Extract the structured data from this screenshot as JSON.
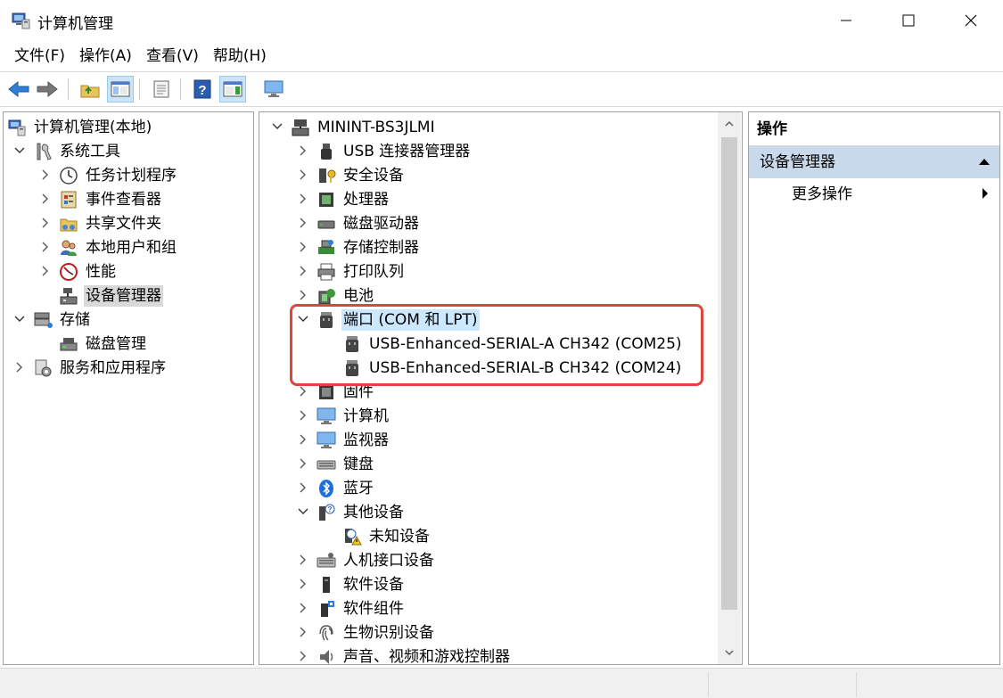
{
  "window": {
    "title": "计算机管理",
    "icon": "computer-management-icon",
    "controls": [
      "minimize",
      "maximize",
      "close"
    ]
  },
  "menu": [
    "文件(F)",
    "操作(A)",
    "查看(V)",
    "帮助(H)"
  ],
  "toolbar": [
    {
      "name": "back-button",
      "icon": "back-arrow-icon"
    },
    {
      "name": "forward-button",
      "icon": "forward-arrow-icon"
    },
    {
      "name": "up-folder-button",
      "icon": "up-folder-icon"
    },
    {
      "name": "show-hide-tree-button",
      "icon": "console-tree-icon",
      "pressed": true
    },
    {
      "name": "properties-button",
      "icon": "properties-icon"
    },
    {
      "name": "help-button",
      "icon": "help-icon"
    },
    {
      "name": "show-hide-action-pane-button",
      "icon": "action-pane-icon",
      "pressed": true
    },
    {
      "name": "monitor-button",
      "icon": "monitor-icon"
    }
  ],
  "left_tree": [
    {
      "label": "计算机管理(本地)",
      "icon": "computer-management-icon",
      "level": 0,
      "chevron": "none"
    },
    {
      "label": "系统工具",
      "icon": "tools-icon",
      "level": 1,
      "chevron": "down"
    },
    {
      "label": "任务计划程序",
      "icon": "clock-icon",
      "level": 2,
      "chevron": "right"
    },
    {
      "label": "事件查看器",
      "icon": "event-viewer-icon",
      "level": 2,
      "chevron": "right"
    },
    {
      "label": "共享文件夹",
      "icon": "shared-folder-icon",
      "level": 2,
      "chevron": "right"
    },
    {
      "label": "本地用户和组",
      "icon": "users-icon",
      "level": 2,
      "chevron": "right"
    },
    {
      "label": "性能",
      "icon": "performance-icon",
      "level": 2,
      "chevron": "right"
    },
    {
      "label": "设备管理器",
      "icon": "device-manager-icon",
      "level": 2,
      "chevron": "none",
      "selected": true
    },
    {
      "label": "存储",
      "icon": "storage-icon",
      "level": 1,
      "chevron": "down"
    },
    {
      "label": "磁盘管理",
      "icon": "disk-management-icon",
      "level": 2,
      "chevron": "none"
    },
    {
      "label": "服务和应用程序",
      "icon": "services-icon",
      "level": 1,
      "chevron": "right"
    }
  ],
  "device_tree": [
    {
      "label": "MININT-BS3JLMI",
      "icon": "computer-root-icon",
      "level": 0,
      "chevron": "down"
    },
    {
      "label": "USB 连接器管理器",
      "icon": "usb-connector-icon",
      "level": 1,
      "chevron": "right"
    },
    {
      "label": "安全设备",
      "icon": "security-device-icon",
      "level": 1,
      "chevron": "right"
    },
    {
      "label": "处理器",
      "icon": "processor-icon",
      "level": 1,
      "chevron": "right"
    },
    {
      "label": "磁盘驱动器",
      "icon": "disk-drive-icon",
      "level": 1,
      "chevron": "right"
    },
    {
      "label": "存储控制器",
      "icon": "storage-controller-icon",
      "level": 1,
      "chevron": "right"
    },
    {
      "label": "打印队列",
      "icon": "printer-icon",
      "level": 1,
      "chevron": "right"
    },
    {
      "label": "电池",
      "icon": "battery-icon",
      "level": 1,
      "chevron": "right"
    },
    {
      "label": "端口 (COM 和 LPT)",
      "icon": "port-icon",
      "level": 1,
      "chevron": "down",
      "focused": true
    },
    {
      "label": "USB-Enhanced-SERIAL-A CH342 (COM25)",
      "icon": "port-icon",
      "level": 2,
      "chevron": "none"
    },
    {
      "label": "USB-Enhanced-SERIAL-B CH342 (COM24)",
      "icon": "port-icon",
      "level": 2,
      "chevron": "none"
    },
    {
      "label": "固件",
      "icon": "firmware-icon",
      "level": 1,
      "chevron": "right"
    },
    {
      "label": "计算机",
      "icon": "computer-icon",
      "level": 1,
      "chevron": "right"
    },
    {
      "label": "监视器",
      "icon": "monitor-icon",
      "level": 1,
      "chevron": "right"
    },
    {
      "label": "键盘",
      "icon": "keyboard-icon",
      "level": 1,
      "chevron": "right"
    },
    {
      "label": "蓝牙",
      "icon": "bluetooth-icon",
      "level": 1,
      "chevron": "right"
    },
    {
      "label": "其他设备",
      "icon": "other-devices-icon",
      "level": 1,
      "chevron": "down"
    },
    {
      "label": "未知设备",
      "icon": "unknown-device-warning-icon",
      "level": 2,
      "chevron": "none"
    },
    {
      "label": "人机接口设备",
      "icon": "hid-icon",
      "level": 1,
      "chevron": "right"
    },
    {
      "label": "软件设备",
      "icon": "software-device-icon",
      "level": 1,
      "chevron": "right"
    },
    {
      "label": "软件组件",
      "icon": "software-component-icon",
      "level": 1,
      "chevron": "right"
    },
    {
      "label": "生物识别设备",
      "icon": "biometric-icon",
      "level": 1,
      "chevron": "right"
    },
    {
      "label": "声音、视频和游戏控制器",
      "icon": "sound-icon",
      "level": 1,
      "chevron": "right"
    }
  ],
  "actions": {
    "title": "操作",
    "group": "设备管理器",
    "item": "更多操作"
  },
  "colors": {
    "highlight_box": "#e0453d",
    "actions_group_bg": "#c9d9ec",
    "focus_bg": "#cce8ff",
    "selected_bg": "#d9d9d9"
  }
}
